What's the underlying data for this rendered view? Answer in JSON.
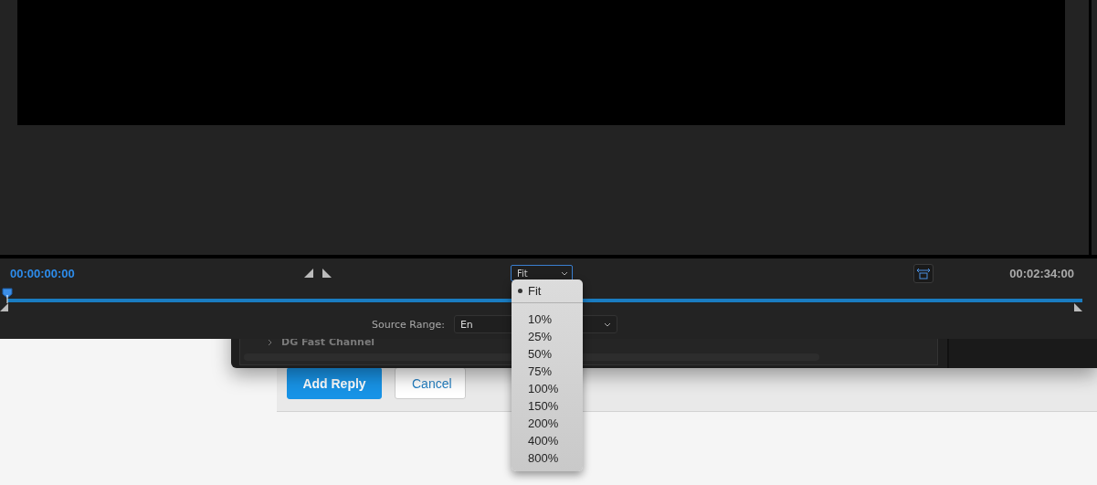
{
  "player": {
    "timecode_start": "00:00:00:00",
    "zoom": {
      "value": "Fit",
      "expanded": true
    },
    "timecode_end": "00:02:34:00",
    "scrubber": {
      "level": 0
    },
    "source_range": {
      "label": "Source Range:",
      "value": "En"
    }
  },
  "zoom_menu": [
    {
      "label": "Fit",
      "selected": true
    },
    {
      "label": "10%",
      "selected": false
    },
    {
      "label": "25%",
      "selected": false
    },
    {
      "label": "50%",
      "selected": false
    },
    {
      "label": "75%",
      "selected": false
    },
    {
      "label": "100%",
      "selected": false
    },
    {
      "label": "150%",
      "selected": false
    },
    {
      "label": "200%",
      "selected": false
    },
    {
      "label": "400%",
      "selected": false
    },
    {
      "label": "800%",
      "selected": false
    }
  ],
  "back_window": {
    "items": [
      {
        "label": "DG Fast Channel"
      }
    ]
  },
  "comment_form": {
    "buttons": [
      {
        "label": "Add Reply",
        "kind": "primary"
      },
      {
        "label": "Cancel",
        "kind": "secondary"
      }
    ]
  }
}
